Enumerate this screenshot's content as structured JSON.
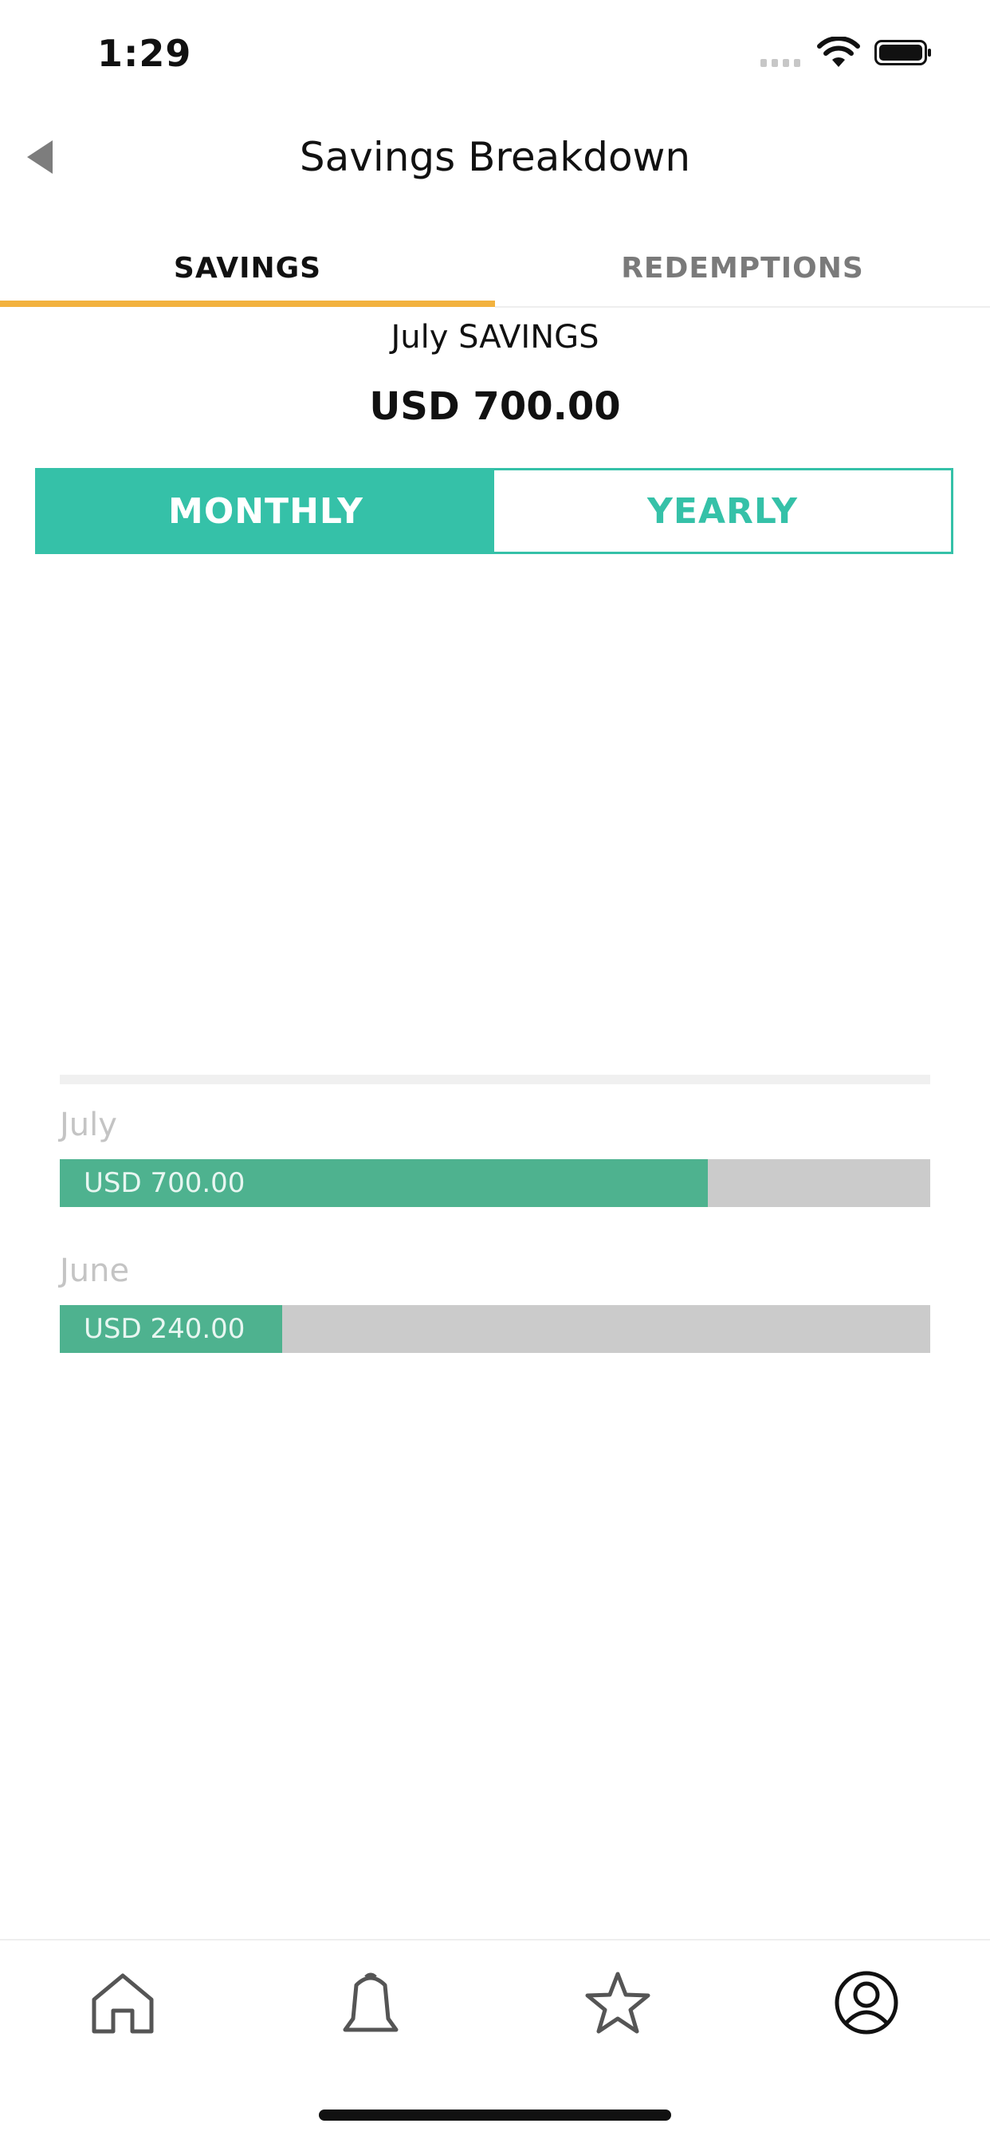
{
  "status_bar": {
    "time": "1:29"
  },
  "header": {
    "title": "Savings Breakdown"
  },
  "tabs": [
    {
      "label": "SAVINGS",
      "active": true
    },
    {
      "label": "REDEMPTIONS",
      "active": false
    }
  ],
  "summary": {
    "period_label": "July SAVINGS",
    "total": "USD 700.00"
  },
  "segmented": {
    "monthly_label": "MONTHLY",
    "yearly_label": "YEARLY",
    "selected": "MONTHLY"
  },
  "chart_data": {
    "type": "bar",
    "categories": [
      "July",
      "June"
    ],
    "values": [
      700,
      240
    ],
    "value_labels": [
      "USD 700.00",
      "USD 240.00"
    ],
    "xlim": [
      0,
      940
    ]
  },
  "colors": {
    "accent": "#35c1a8",
    "bar_fill": "#4eb28f",
    "bar_track": "#cbcbcb",
    "tab_indicator": "#f2b23f"
  },
  "nav": [
    "home-icon",
    "bell-icon",
    "star-icon",
    "profile-icon"
  ]
}
